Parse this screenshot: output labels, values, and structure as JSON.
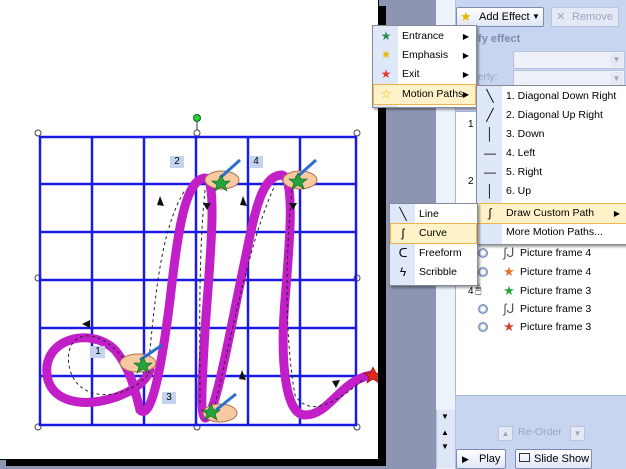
{
  "toolbar": {
    "add_effect_label": "Add Effect",
    "remove_label": "Remove"
  },
  "pane": {
    "modify_effect_heading": "ify effect",
    "property_label": "erty:",
    "list_numbers": [
      "1",
      "2",
      "4"
    ],
    "list_items": [
      {
        "icon": "custom-path-icon",
        "label": "Picture frame 4"
      },
      {
        "icon": "emphasis-star-icon",
        "label": "Picture frame 4"
      },
      {
        "icon": "entrance-star-icon",
        "label": "Picture frame 3"
      },
      {
        "icon": "custom-path-icon",
        "label": "Picture frame 3"
      },
      {
        "icon": "exit-star-icon",
        "label": "Picture frame 3"
      }
    ],
    "reorder_label": "Re-Order",
    "play_label": "Play",
    "slideshow_label": "Slide Show"
  },
  "menu_main": {
    "items": [
      {
        "label": "Entrance",
        "icon": "entrance-star-icon",
        "color": "#2e8b57"
      },
      {
        "label": "Emphasis",
        "icon": "emphasis-star-icon",
        "color": "#e8b800"
      },
      {
        "label": "Exit",
        "icon": "exit-star-icon",
        "color": "#e03c2c"
      },
      {
        "label": "Motion Paths",
        "icon": "motion-path-star-icon",
        "color": "#ffffff"
      }
    ]
  },
  "menu_paths": {
    "items": [
      {
        "label": "1. Diagonal Down Right",
        "icon": "diagonal-down-icon"
      },
      {
        "label": "2. Diagonal Up Right",
        "icon": "diagonal-up-icon"
      },
      {
        "label": "3. Down",
        "icon": "down-line-icon"
      },
      {
        "label": "4. Left",
        "icon": "left-line-icon"
      },
      {
        "label": "5. Right",
        "icon": "right-line-icon"
      },
      {
        "label": "6. Up",
        "icon": "up-line-icon"
      },
      {
        "label": "Draw Custom Path",
        "icon": "custom-path-icon"
      },
      {
        "label": "More Motion Paths...",
        "icon": ""
      }
    ]
  },
  "menu_custom": {
    "items": [
      {
        "label": "Line",
        "icon": "line-tool-icon"
      },
      {
        "label": "Curve",
        "icon": "curve-tool-icon"
      },
      {
        "label": "Freeform",
        "icon": "freeform-tool-icon"
      },
      {
        "label": "Scribble",
        "icon": "scribble-tool-icon"
      }
    ]
  },
  "slide": {
    "step_labels": [
      "1",
      "2",
      "3",
      "4"
    ],
    "grid_color": "#1a1ae6",
    "stroke_color": "#c21fc8"
  }
}
